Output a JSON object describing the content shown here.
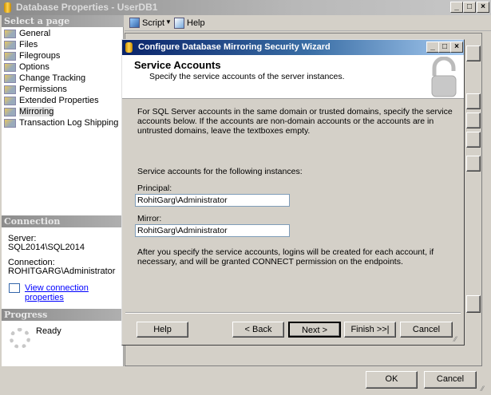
{
  "window": {
    "title": "Database Properties - UserDB1",
    "min": "_",
    "max": "□",
    "close": "×"
  },
  "toolbar": {
    "script": "Script",
    "help": "Help"
  },
  "left": {
    "select_header": "Select a page",
    "items": [
      {
        "label": "General"
      },
      {
        "label": "Files"
      },
      {
        "label": "Filegroups"
      },
      {
        "label": "Options"
      },
      {
        "label": "Change Tracking"
      },
      {
        "label": "Permissions"
      },
      {
        "label": "Extended Properties"
      },
      {
        "label": "Mirroring"
      },
      {
        "label": "Transaction Log Shipping"
      }
    ],
    "selected": "Mirroring",
    "connection_header": "Connection",
    "server_label": "Server:",
    "server_value": "SQL2014\\SQL2014",
    "connection_label": "Connection:",
    "connection_value": "ROHITGARG\\Administrator",
    "view_link": "View connection properties",
    "progress_header": "Progress",
    "progress_status": "Ready"
  },
  "wizard": {
    "title": "Configure Database Mirroring Security Wizard",
    "heading": "Service Accounts",
    "subheading": "Specify the service accounts of the server instances.",
    "intro": "For SQL Server accounts in the same domain or trusted domains, specify the service accounts below. If the accounts are non-domain accounts or the accounts are in untrusted domains, leave the textboxes empty.",
    "instances_label": "Service accounts for the following instances:",
    "principal_label": "Principal:",
    "principal_value": "RohitGarg\\Administrator",
    "mirror_label": "Mirror:",
    "mirror_value": "RohitGarg\\Administrator",
    "footer_note": "After you specify the service accounts, logins will be created for each account, if necessary, and will be granted CONNECT permission on the endpoints.",
    "buttons": {
      "help": "Help",
      "back": "< Back",
      "next": "Next >",
      "finish": "Finish >>|",
      "cancel": "Cancel"
    }
  },
  "footer": {
    "ok": "OK",
    "cancel": "Cancel"
  },
  "colors": {
    "wizard_title": "#0a246a",
    "link": "#0000ff"
  }
}
